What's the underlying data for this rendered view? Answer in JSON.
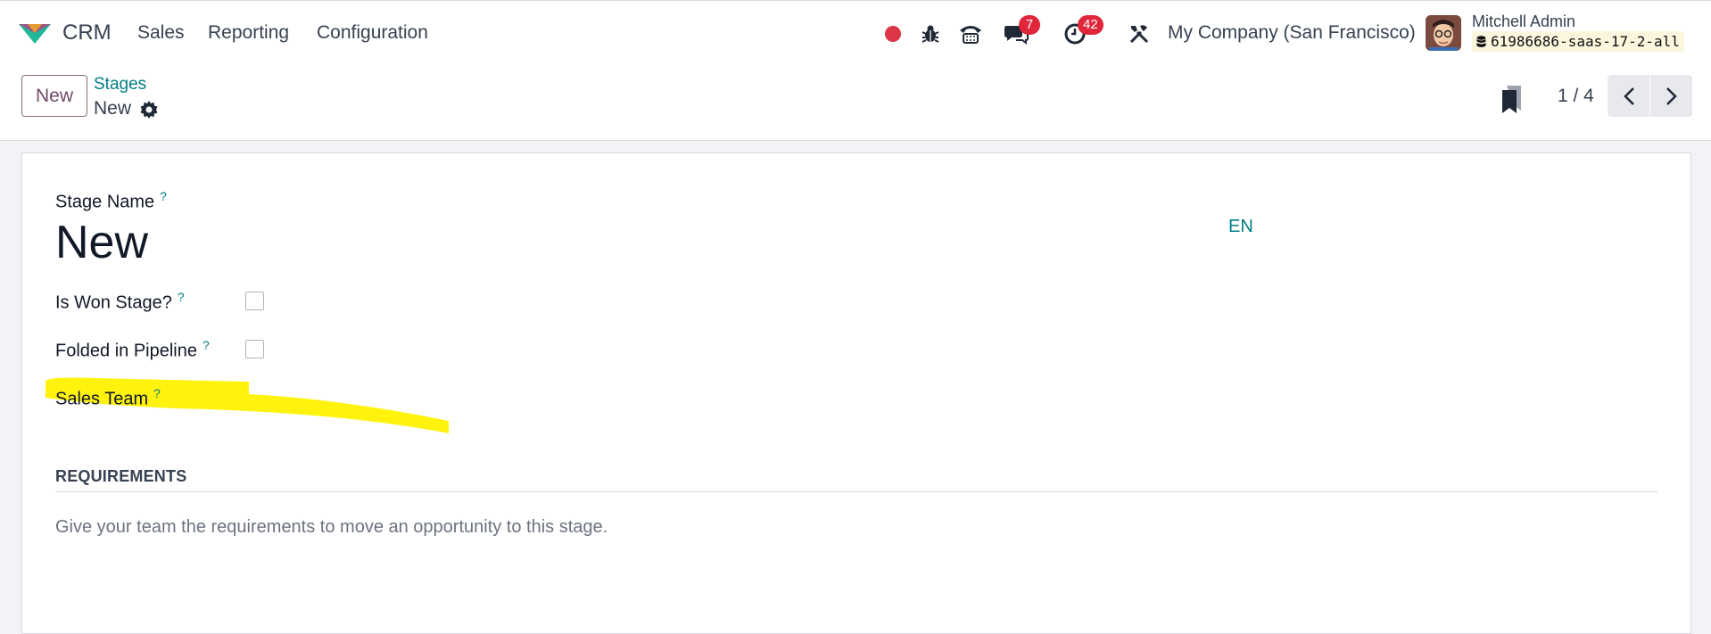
{
  "navbar": {
    "app_name": "CRM",
    "menu": [
      "Sales",
      "Reporting",
      "Configuration"
    ],
    "messages_badge": "7",
    "activities_badge": "42",
    "company": "My Company (San Francisco)",
    "user_name": "Mitchell Admin",
    "database": "61986686-saas-17-2-all",
    "icons": [
      "record-icon",
      "bug-icon",
      "phone-icon",
      "chat-icon",
      "clock-icon",
      "tools-icon",
      "database-icon"
    ],
    "colors": {
      "record": "#dc3545",
      "badge": "#e0263a",
      "brand_teal": "#017e84"
    }
  },
  "control_panel": {
    "new_button": "New",
    "breadcrumb_parent": "Stages",
    "breadcrumb_current": "New",
    "pager": "1 / 4"
  },
  "form": {
    "stage_name_label": "Stage Name",
    "stage_name_value": "New",
    "language": "EN",
    "tooltip_mark": "?",
    "is_won_label": "Is Won Stage?",
    "is_won_checked": false,
    "folded_label": "Folded in Pipeline",
    "folded_checked": false,
    "sales_team_label": "Sales Team",
    "requirements_title": "REQUIREMENTS",
    "requirements_placeholder": "Give your team the requirements to move an opportunity to this stage."
  }
}
